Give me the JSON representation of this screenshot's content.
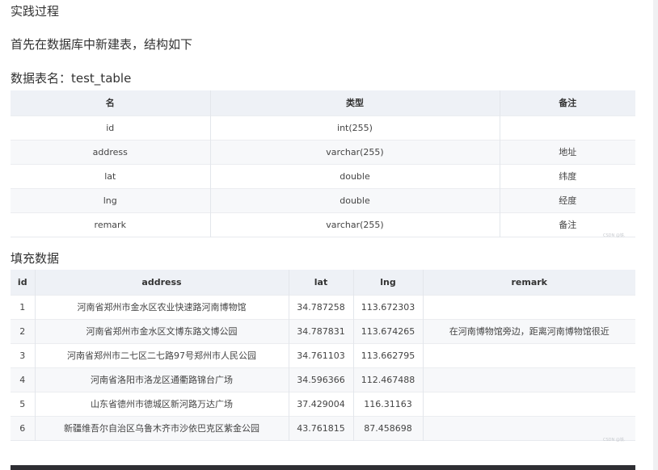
{
  "headings": {
    "practice": "实践过程",
    "intro": "首先在数据库中新建表，结构如下",
    "table_name": "数据表名：test_table",
    "fill_data": "填充数据"
  },
  "schema_table": {
    "columns": [
      "名",
      "类型",
      "备注"
    ],
    "rows": [
      {
        "name": "id",
        "type": "int(255)",
        "comment": ""
      },
      {
        "name": "address",
        "type": "varchar(255)",
        "comment": "地址"
      },
      {
        "name": "lat",
        "type": "double",
        "comment": "纬度"
      },
      {
        "name": "lng",
        "type": "double",
        "comment": "经度"
      },
      {
        "name": "remark",
        "type": "varchar(255)",
        "comment": "备注"
      }
    ]
  },
  "data_table": {
    "columns": [
      "id",
      "address",
      "lat",
      "lng",
      "remark"
    ],
    "rows": [
      {
        "id": "1",
        "address": "河南省郑州市金水区农业快速路河南博物馆",
        "lat": "34.787258",
        "lng": "113.672303",
        "remark": ""
      },
      {
        "id": "2",
        "address": "河南省郑州市金水区文博东路文博公园",
        "lat": "34.787831",
        "lng": "113.674265",
        "remark": "在河南博物馆旁边，距离河南博物馆很近"
      },
      {
        "id": "3",
        "address": "河南省郑州市二七区二七路97号郑州市人民公园",
        "lat": "34.761103",
        "lng": "113.662795",
        "remark": ""
      },
      {
        "id": "4",
        "address": "河南省洛阳市洛龙区通衢路锦台广场",
        "lat": "34.596366",
        "lng": "112.467488",
        "remark": ""
      },
      {
        "id": "5",
        "address": "山东省德州市德城区新河路万达广场",
        "lat": "37.429004",
        "lng": "116.31163",
        "remark": ""
      },
      {
        "id": "6",
        "address": "新疆维吾尔自治区乌鲁木齐市沙依巴克区紫金公园",
        "lat": "43.761815",
        "lng": "87.458698",
        "remark": ""
      }
    ]
  },
  "watermark": "CSDN @铁.",
  "colors": {
    "header_bg": "#eef1f6",
    "stripe_bg": "#f7f8fa",
    "bottom_bar": "#2e2e33"
  }
}
